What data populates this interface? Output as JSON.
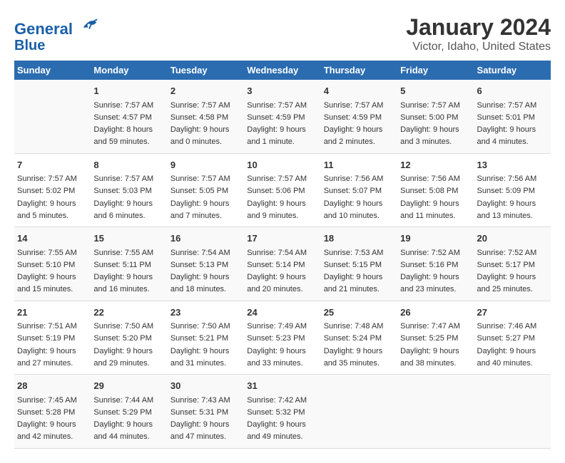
{
  "header": {
    "logo_line1": "General",
    "logo_line2": "Blue",
    "title": "January 2024",
    "subtitle": "Victor, Idaho, United States"
  },
  "columns": [
    "Sunday",
    "Monday",
    "Tuesday",
    "Wednesday",
    "Thursday",
    "Friday",
    "Saturday"
  ],
  "weeks": [
    [
      {
        "day": "",
        "sunrise": "",
        "sunset": "",
        "daylight": ""
      },
      {
        "day": "1",
        "sunrise": "Sunrise: 7:57 AM",
        "sunset": "Sunset: 4:57 PM",
        "daylight": "Daylight: 8 hours and 59 minutes."
      },
      {
        "day": "2",
        "sunrise": "Sunrise: 7:57 AM",
        "sunset": "Sunset: 4:58 PM",
        "daylight": "Daylight: 9 hours and 0 minutes."
      },
      {
        "day": "3",
        "sunrise": "Sunrise: 7:57 AM",
        "sunset": "Sunset: 4:59 PM",
        "daylight": "Daylight: 9 hours and 1 minute."
      },
      {
        "day": "4",
        "sunrise": "Sunrise: 7:57 AM",
        "sunset": "Sunset: 4:59 PM",
        "daylight": "Daylight: 9 hours and 2 minutes."
      },
      {
        "day": "5",
        "sunrise": "Sunrise: 7:57 AM",
        "sunset": "Sunset: 5:00 PM",
        "daylight": "Daylight: 9 hours and 3 minutes."
      },
      {
        "day": "6",
        "sunrise": "Sunrise: 7:57 AM",
        "sunset": "Sunset: 5:01 PM",
        "daylight": "Daylight: 9 hours and 4 minutes."
      }
    ],
    [
      {
        "day": "7",
        "sunrise": "Sunrise: 7:57 AM",
        "sunset": "Sunset: 5:02 PM",
        "daylight": "Daylight: 9 hours and 5 minutes."
      },
      {
        "day": "8",
        "sunrise": "Sunrise: 7:57 AM",
        "sunset": "Sunset: 5:03 PM",
        "daylight": "Daylight: 9 hours and 6 minutes."
      },
      {
        "day": "9",
        "sunrise": "Sunrise: 7:57 AM",
        "sunset": "Sunset: 5:05 PM",
        "daylight": "Daylight: 9 hours and 7 minutes."
      },
      {
        "day": "10",
        "sunrise": "Sunrise: 7:57 AM",
        "sunset": "Sunset: 5:06 PM",
        "daylight": "Daylight: 9 hours and 9 minutes."
      },
      {
        "day": "11",
        "sunrise": "Sunrise: 7:56 AM",
        "sunset": "Sunset: 5:07 PM",
        "daylight": "Daylight: 9 hours and 10 minutes."
      },
      {
        "day": "12",
        "sunrise": "Sunrise: 7:56 AM",
        "sunset": "Sunset: 5:08 PM",
        "daylight": "Daylight: 9 hours and 11 minutes."
      },
      {
        "day": "13",
        "sunrise": "Sunrise: 7:56 AM",
        "sunset": "Sunset: 5:09 PM",
        "daylight": "Daylight: 9 hours and 13 minutes."
      }
    ],
    [
      {
        "day": "14",
        "sunrise": "Sunrise: 7:55 AM",
        "sunset": "Sunset: 5:10 PM",
        "daylight": "Daylight: 9 hours and 15 minutes."
      },
      {
        "day": "15",
        "sunrise": "Sunrise: 7:55 AM",
        "sunset": "Sunset: 5:11 PM",
        "daylight": "Daylight: 9 hours and 16 minutes."
      },
      {
        "day": "16",
        "sunrise": "Sunrise: 7:54 AM",
        "sunset": "Sunset: 5:13 PM",
        "daylight": "Daylight: 9 hours and 18 minutes."
      },
      {
        "day": "17",
        "sunrise": "Sunrise: 7:54 AM",
        "sunset": "Sunset: 5:14 PM",
        "daylight": "Daylight: 9 hours and 20 minutes."
      },
      {
        "day": "18",
        "sunrise": "Sunrise: 7:53 AM",
        "sunset": "Sunset: 5:15 PM",
        "daylight": "Daylight: 9 hours and 21 minutes."
      },
      {
        "day": "19",
        "sunrise": "Sunrise: 7:52 AM",
        "sunset": "Sunset: 5:16 PM",
        "daylight": "Daylight: 9 hours and 23 minutes."
      },
      {
        "day": "20",
        "sunrise": "Sunrise: 7:52 AM",
        "sunset": "Sunset: 5:17 PM",
        "daylight": "Daylight: 9 hours and 25 minutes."
      }
    ],
    [
      {
        "day": "21",
        "sunrise": "Sunrise: 7:51 AM",
        "sunset": "Sunset: 5:19 PM",
        "daylight": "Daylight: 9 hours and 27 minutes."
      },
      {
        "day": "22",
        "sunrise": "Sunrise: 7:50 AM",
        "sunset": "Sunset: 5:20 PM",
        "daylight": "Daylight: 9 hours and 29 minutes."
      },
      {
        "day": "23",
        "sunrise": "Sunrise: 7:50 AM",
        "sunset": "Sunset: 5:21 PM",
        "daylight": "Daylight: 9 hours and 31 minutes."
      },
      {
        "day": "24",
        "sunrise": "Sunrise: 7:49 AM",
        "sunset": "Sunset: 5:23 PM",
        "daylight": "Daylight: 9 hours and 33 minutes."
      },
      {
        "day": "25",
        "sunrise": "Sunrise: 7:48 AM",
        "sunset": "Sunset: 5:24 PM",
        "daylight": "Daylight: 9 hours and 35 minutes."
      },
      {
        "day": "26",
        "sunrise": "Sunrise: 7:47 AM",
        "sunset": "Sunset: 5:25 PM",
        "daylight": "Daylight: 9 hours and 38 minutes."
      },
      {
        "day": "27",
        "sunrise": "Sunrise: 7:46 AM",
        "sunset": "Sunset: 5:27 PM",
        "daylight": "Daylight: 9 hours and 40 minutes."
      }
    ],
    [
      {
        "day": "28",
        "sunrise": "Sunrise: 7:45 AM",
        "sunset": "Sunset: 5:28 PM",
        "daylight": "Daylight: 9 hours and 42 minutes."
      },
      {
        "day": "29",
        "sunrise": "Sunrise: 7:44 AM",
        "sunset": "Sunset: 5:29 PM",
        "daylight": "Daylight: 9 hours and 44 minutes."
      },
      {
        "day": "30",
        "sunrise": "Sunrise: 7:43 AM",
        "sunset": "Sunset: 5:31 PM",
        "daylight": "Daylight: 9 hours and 47 minutes."
      },
      {
        "day": "31",
        "sunrise": "Sunrise: 7:42 AM",
        "sunset": "Sunset: 5:32 PM",
        "daylight": "Daylight: 9 hours and 49 minutes."
      },
      {
        "day": "",
        "sunrise": "",
        "sunset": "",
        "daylight": ""
      },
      {
        "day": "",
        "sunrise": "",
        "sunset": "",
        "daylight": ""
      },
      {
        "day": "",
        "sunrise": "",
        "sunset": "",
        "daylight": ""
      }
    ]
  ]
}
